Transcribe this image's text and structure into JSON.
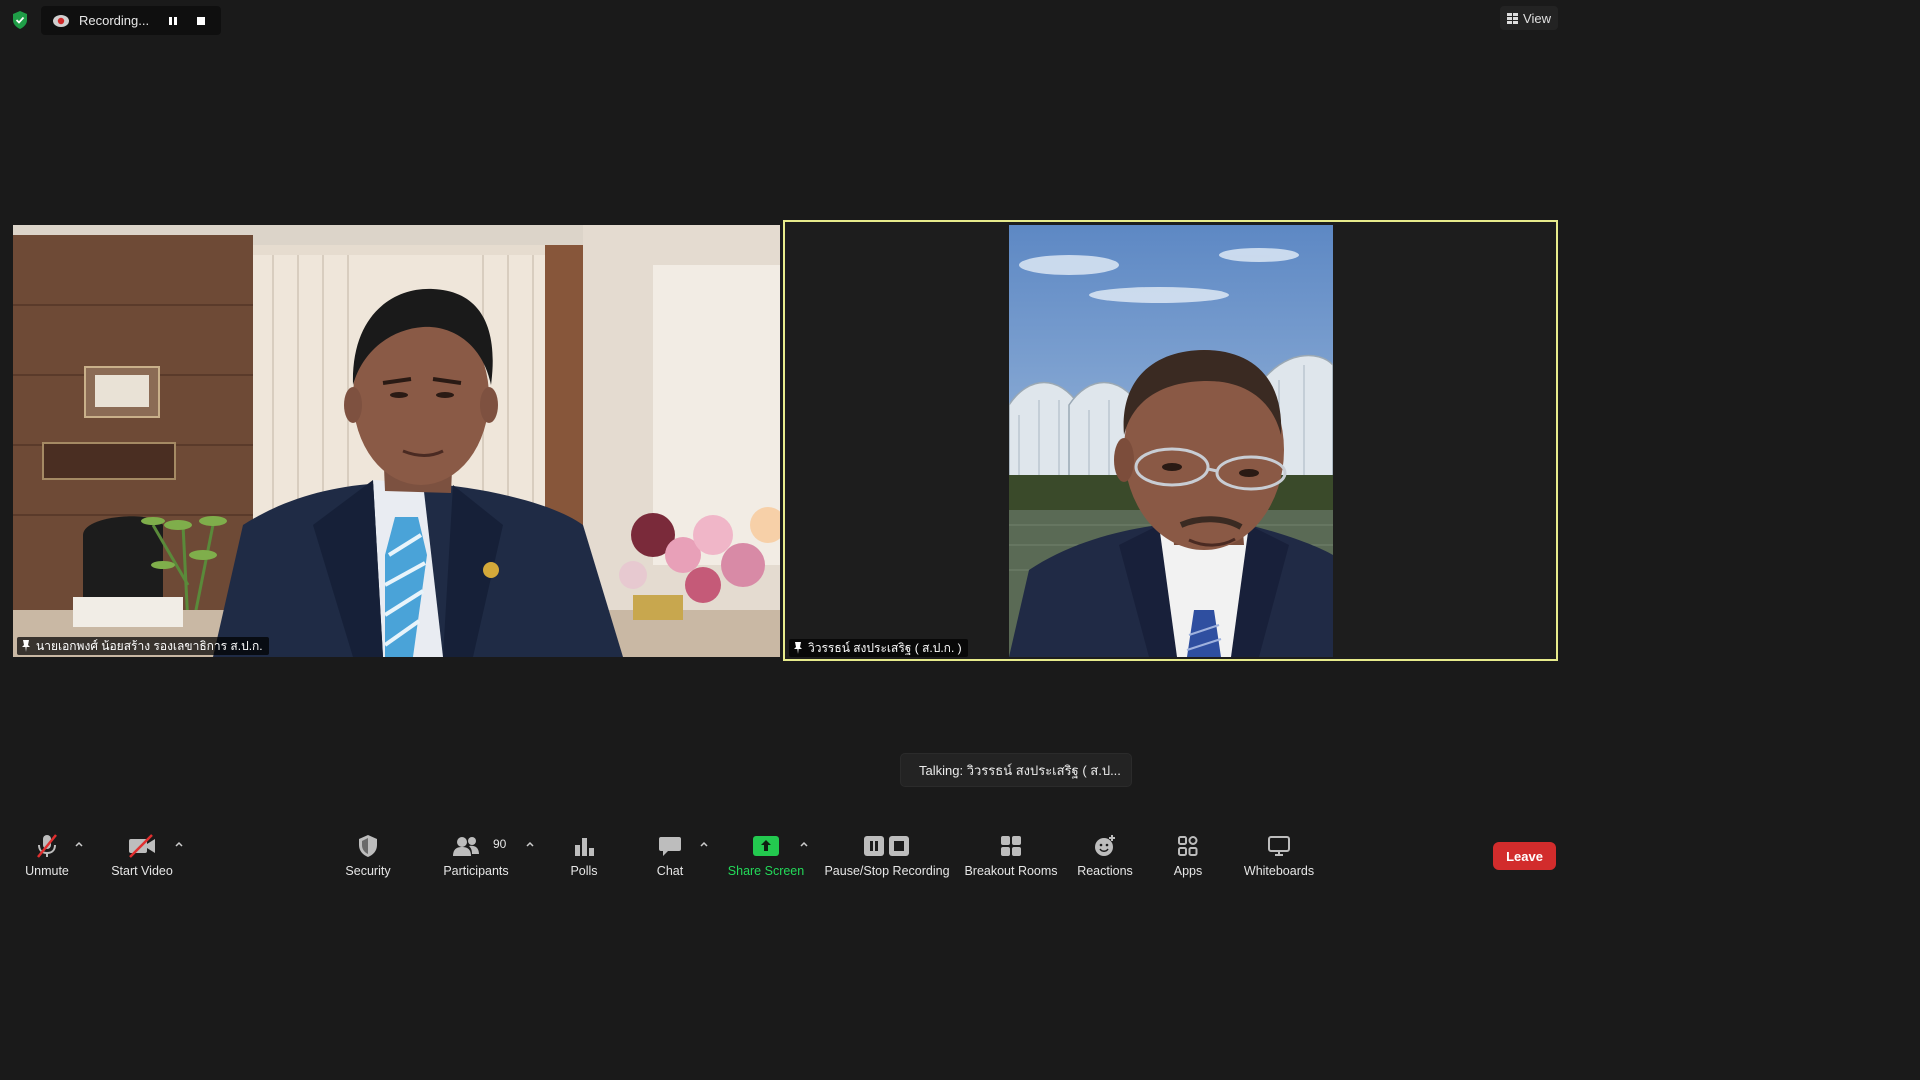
{
  "top_bar": {
    "recording_label": "Recording...",
    "view_label": "View"
  },
  "participants_video": [
    {
      "name": "นายเอกพงศ์ น้อยสร้าง รองเลขาธิการ ส.ป.ก."
    },
    {
      "name": "วิวรรธน์ สงประเสริฐ ( ส.ป.ก. )"
    }
  ],
  "talking_indicator": "Talking: วิวรรธน์ สงประเสริฐ ( ส.ป...",
  "toolbar": {
    "unmute": "Unmute",
    "start_video": "Start Video",
    "security": "Security",
    "participants": "Participants",
    "participants_count": "90",
    "polls": "Polls",
    "chat": "Chat",
    "share_screen": "Share Screen",
    "recording": "Pause/Stop Recording",
    "breakout_rooms": "Breakout Rooms",
    "reactions": "Reactions",
    "apps": "Apps",
    "whiteboards": "Whiteboards",
    "leave": "Leave"
  },
  "colors": {
    "background": "#1a1a1a",
    "active_speaker_border": "#e7eb8c",
    "share_green": "#23d959",
    "leave_red": "#d22c2c"
  },
  "icons": [
    "shield-check-icon",
    "recording-icon",
    "pause-icon",
    "stop-icon",
    "grid-view-icon",
    "pin-icon",
    "microphone-muted-icon",
    "video-off-icon",
    "security-shield-icon",
    "participants-icon",
    "polls-icon",
    "chat-bubble-icon",
    "share-screen-icon",
    "pause-stop-recording-icon",
    "breakout-rooms-icon",
    "reactions-icon",
    "apps-icon",
    "whiteboard-icon",
    "chevron-up-icon"
  ]
}
